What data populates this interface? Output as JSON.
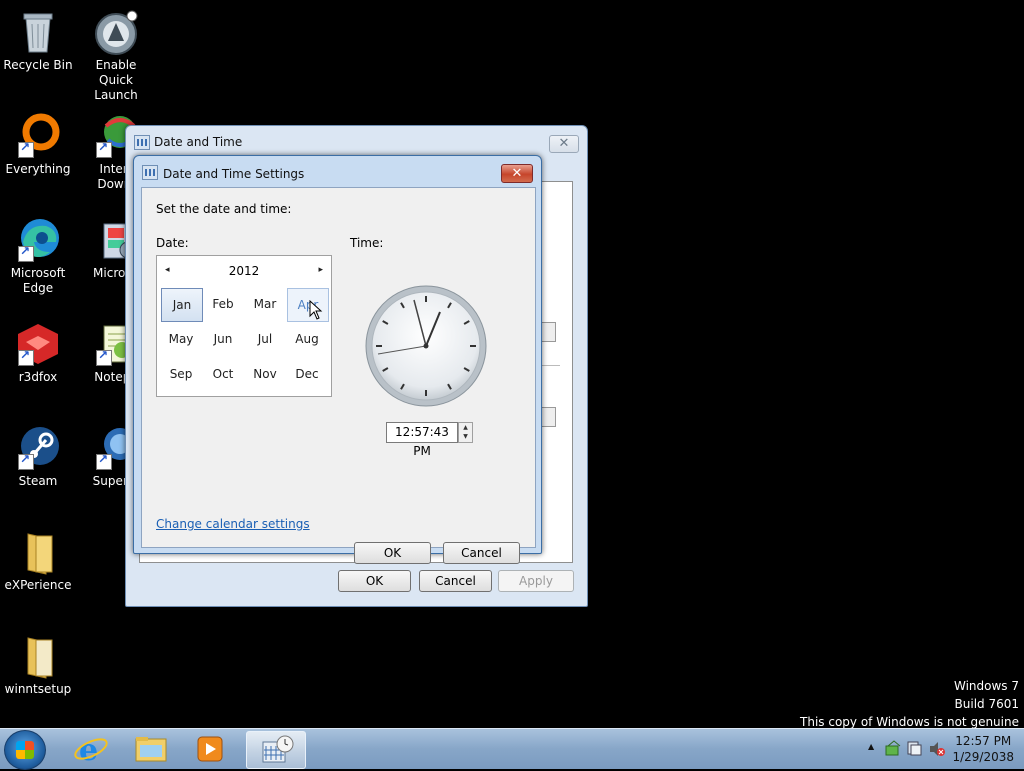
{
  "desktop": {
    "icons": [
      {
        "label": "Recycle Bin"
      },
      {
        "label": "Enable Quick\nLaunch"
      },
      {
        "label": "Everything"
      },
      {
        "label": "Interr\nDownl"
      },
      {
        "label": "Microsoft\nEdge"
      },
      {
        "label": "Microso"
      },
      {
        "label": "r3dfox"
      },
      {
        "label": "Notepa"
      },
      {
        "label": "Steam"
      },
      {
        "label": "Superm"
      },
      {
        "label": "eXPerience"
      },
      {
        "label": "winntsetup"
      }
    ]
  },
  "outer_window": {
    "title": "Date and Time",
    "close_glyph": "✕",
    "ok_label": "OK",
    "cancel_label": "Cancel",
    "apply_label": "Apply"
  },
  "dialog": {
    "title": "Date and Time Settings",
    "close_glyph": "✕",
    "instruction": "Set the date and time:",
    "date_label": "Date:",
    "time_label": "Time:",
    "calendar": {
      "year": "2012",
      "prev_glyph": "◂",
      "next_glyph": "▸",
      "months": [
        "Jan",
        "Feb",
        "Mar",
        "Apr",
        "May",
        "Jun",
        "Jul",
        "Aug",
        "Sep",
        "Oct",
        "Nov",
        "Dec"
      ],
      "selected_month": "Jan",
      "hover_month": "Apr"
    },
    "time_value": "12:57:43 PM",
    "change_calendar_link": "Change calendar settings",
    "ok_label": "OK",
    "cancel_label": "Cancel"
  },
  "watermark": {
    "line1": "Windows 7",
    "line2": "Build 7601",
    "line3": "This copy of Windows is not genuine"
  },
  "taskbar": {
    "time": "12:57 PM",
    "date": "1/29/2038",
    "tray_arrow": "▲"
  },
  "colors": {
    "desktop_bg": "#000000",
    "link": "#1a5fb4",
    "close_red": "#c6452b"
  }
}
